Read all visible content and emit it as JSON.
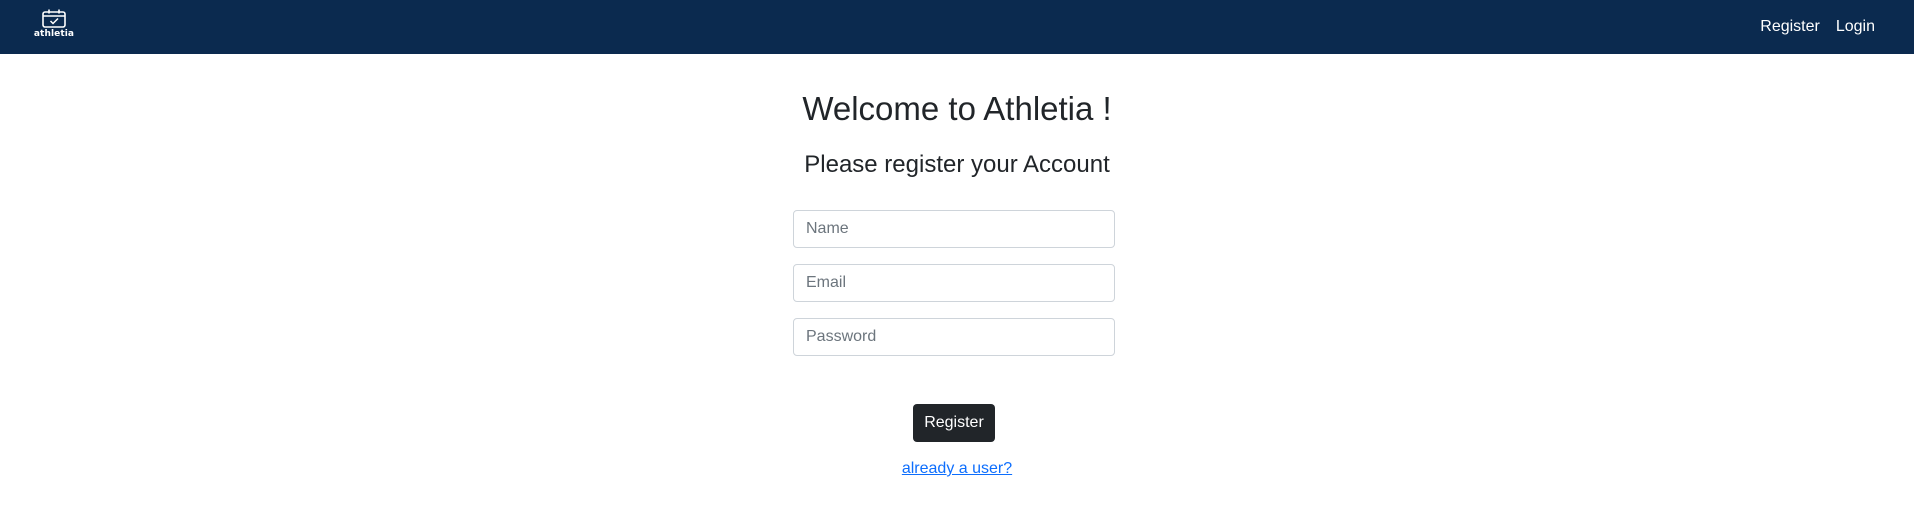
{
  "nav": {
    "brand_text": "athletia",
    "brand_icon": "calendar-check-icon",
    "links": [
      "Register",
      "Login"
    ],
    "background_color": "#0b2a4f"
  },
  "main": {
    "title": "Welcome to Athletia !",
    "subtitle": "Please register your Account",
    "fields": {
      "name_placeholder": "Name",
      "email_placeholder": "Email",
      "password_placeholder": "Password"
    },
    "register_button": "Register",
    "login_link": "already a user?",
    "accent_color": "#0d6efd"
  }
}
